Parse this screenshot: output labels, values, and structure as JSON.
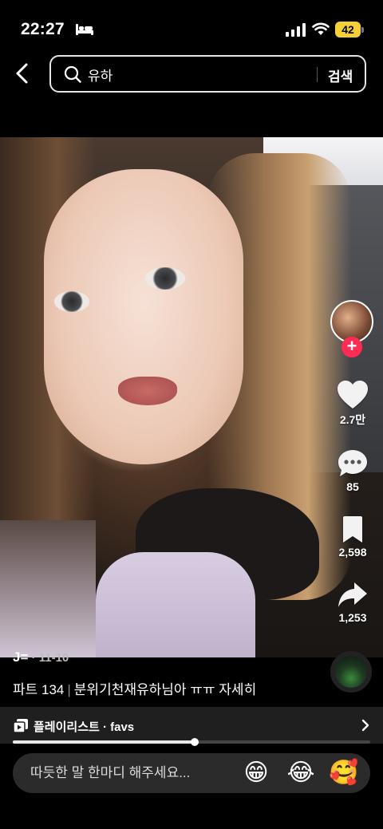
{
  "status_bar": {
    "time": "22:27",
    "battery": "42",
    "icons": [
      "bed-icon",
      "signal-icon",
      "wifi-icon",
      "battery-icon"
    ]
  },
  "search": {
    "query": "유하",
    "button_label": "검색"
  },
  "actions": {
    "likes": "2.7만",
    "comments": "85",
    "bookmarks": "2,598",
    "shares": "1,253"
  },
  "post": {
    "username": "J=",
    "date": " · 11-10",
    "caption_part": "파트 134",
    "caption_separator": "|",
    "caption_text": "분위기천재유하님아 ㅠㅠ 자세히"
  },
  "playlist": {
    "label": "플레이리스트 · favs"
  },
  "progress": {
    "fraction": 0.51
  },
  "comment_bar": {
    "placeholder": "따듯한 말 한마디 해주세요...",
    "emojis": [
      "😁",
      "😂",
      "🥰"
    ]
  },
  "colors": {
    "accent": "#fe2c55",
    "battery": "#f5d038",
    "background": "#000000"
  }
}
